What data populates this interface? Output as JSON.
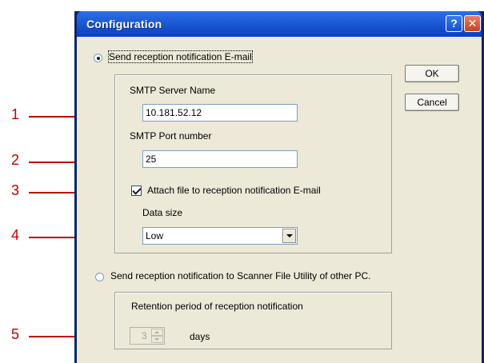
{
  "window": {
    "title": "Configuration",
    "help_glyph": "?",
    "close_glyph": "✕"
  },
  "options": {
    "email": {
      "label": "Send reception notification E-mail",
      "selected": true,
      "smtp_server": {
        "label": "SMTP Server Name",
        "value": "10.181.52.12"
      },
      "smtp_port": {
        "label": "SMTP Port number",
        "value": "25"
      },
      "attach": {
        "label": "Attach file to reception notification E-mail",
        "checked": true
      },
      "data_size": {
        "label": "Data size",
        "value": "Low"
      }
    },
    "utility": {
      "label": "Send reception notification to Scanner File Utility of other PC.",
      "selected": false,
      "retention": {
        "label": "Retention period of reception notification",
        "value": "3",
        "unit": "days"
      }
    }
  },
  "buttons": {
    "ok": "OK",
    "cancel": "Cancel"
  },
  "callouts": [
    "1",
    "2",
    "3",
    "4",
    "5"
  ],
  "colors": {
    "callout": "#c00000",
    "titlebar": "#0a3fc0",
    "dialog": "#ece9d8"
  }
}
